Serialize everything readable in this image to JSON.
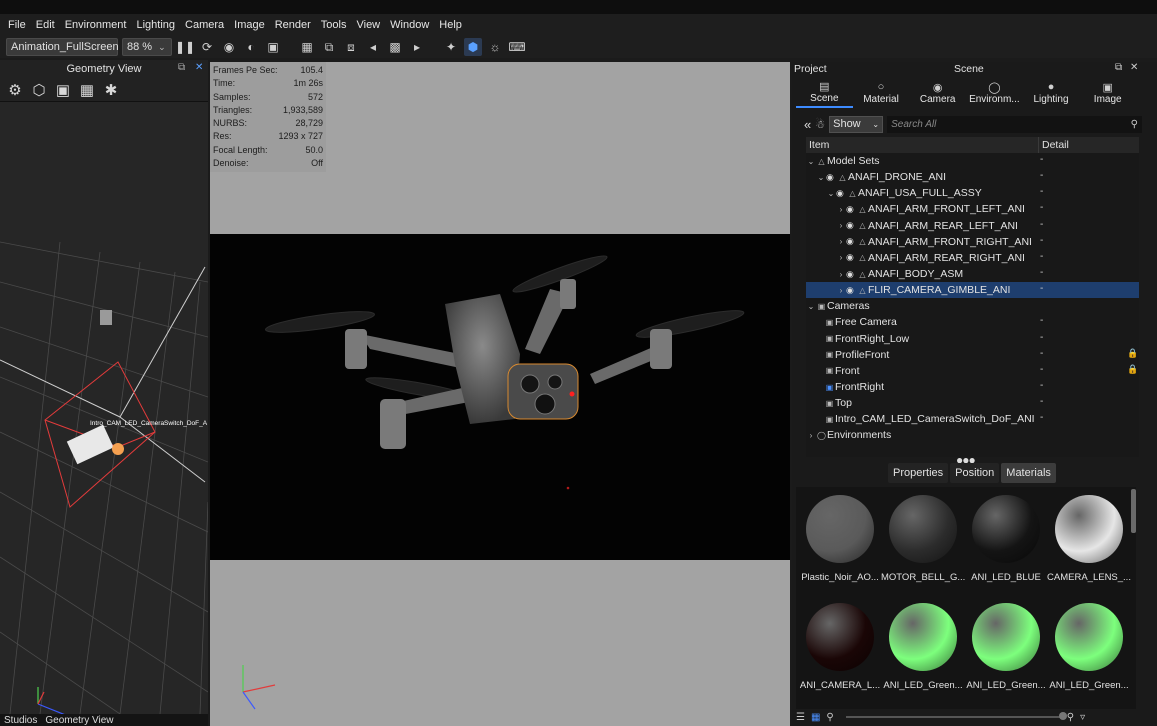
{
  "menu": [
    "File",
    "Edit",
    "Environment",
    "Lighting",
    "Camera",
    "Image",
    "Render",
    "Tools",
    "View",
    "Window",
    "Help"
  ],
  "toolbar": {
    "preset": "Animation_FullScreen",
    "zoom": "88 %"
  },
  "geometry_view": {
    "title": "Geometry View",
    "overlay_label": "Intro_CAM_LED_CameraSwitch_DoF_A"
  },
  "bottom_bar": {
    "left": "Studios",
    "right": "Geometry View"
  },
  "stats": [
    {
      "label": "Frames Pe Sec:",
      "value": "105.4"
    },
    {
      "label": "Time:",
      "value": "1m 26s"
    },
    {
      "label": "Samples:",
      "value": "572"
    },
    {
      "label": "Triangles:",
      "value": "1,933,589"
    },
    {
      "label": "NURBS:",
      "value": "28,729"
    },
    {
      "label": "Res:",
      "value": "1293 x 727"
    },
    {
      "label": "Focal Length:",
      "value": "50.0"
    },
    {
      "label": "Denoise:",
      "value": "Off"
    }
  ],
  "right_panel": {
    "project_label": "Project",
    "scene_label": "Scene",
    "tabs": [
      {
        "label": "Scene",
        "icon": "scene-icon"
      },
      {
        "label": "Material",
        "icon": "material-icon"
      },
      {
        "label": "Camera",
        "icon": "camera-icon"
      },
      {
        "label": "Environm...",
        "icon": "environment-icon"
      },
      {
        "label": "Lighting",
        "icon": "lighting-icon"
      },
      {
        "label": "Image",
        "icon": "image-icon"
      }
    ],
    "filter": "Show",
    "search_placeholder": "Search All",
    "columns": [
      "Item",
      "Detail"
    ],
    "tree": [
      {
        "label": "Model Sets",
        "detail": "-",
        "indent": 0
      },
      {
        "label": "ANAFI_DRONE_ANI",
        "detail": "-",
        "indent": 1
      },
      {
        "label": "ANAFI_USA_FULL_ASSY",
        "detail": "-",
        "indent": 2
      },
      {
        "label": "ANAFI_ARM_FRONT_LEFT_ANI",
        "detail": "-",
        "indent": 3
      },
      {
        "label": "ANAFI_ARM_REAR_LEFT_ANI",
        "detail": "-",
        "indent": 3
      },
      {
        "label": "ANAFI_ARM_FRONT_RIGHT_ANI",
        "detail": "-",
        "indent": 3
      },
      {
        "label": "ANAFI_ARM_REAR_RIGHT_ANI",
        "detail": "-",
        "indent": 3
      },
      {
        "label": "ANAFI_BODY_ASM",
        "detail": "-",
        "indent": 3
      },
      {
        "label": "FLIR_CAMERA_GIMBLE_ANI",
        "detail": "-",
        "indent": 3
      },
      {
        "label": "Cameras",
        "detail": "",
        "indent": 0
      },
      {
        "label": "Free Camera",
        "detail": "-",
        "indent": 1
      },
      {
        "label": "FrontRight_Low",
        "detail": "-",
        "indent": 1
      },
      {
        "label": "ProfileFront",
        "detail": "-",
        "indent": 1
      },
      {
        "label": "Front",
        "detail": "-",
        "indent": 1
      },
      {
        "label": "FrontRight",
        "detail": "-",
        "indent": 1
      },
      {
        "label": "Top",
        "detail": "-",
        "indent": 1
      },
      {
        "label": "Intro_CAM_LED_CameraSwitch_DoF_ANI",
        "detail": "-",
        "indent": 1
      },
      {
        "label": "Environments",
        "detail": "",
        "indent": 0
      }
    ],
    "prop_tabs": [
      "Properties",
      "Position",
      "Materials"
    ],
    "materials": [
      {
        "name": "Plastic_Noir_AO...",
        "color": "#5a5a5a"
      },
      {
        "name": "MOTOR_BELL_G...",
        "color": "#2c2c2c"
      },
      {
        "name": "ANI_LED_BLUE",
        "color": "#141414"
      },
      {
        "name": "CAMERA_LENS_...",
        "color": "#e6e6e6"
      },
      {
        "name": "ANI_CAMERA_L...",
        "color": "#1a0606"
      },
      {
        "name": "ANI_LED_Green...",
        "color": "#7dff7d"
      },
      {
        "name": "ANI_LED_Green...",
        "color": "#7dff7d"
      },
      {
        "name": "ANI_LED_Green...",
        "color": "#7dff7d"
      }
    ]
  }
}
